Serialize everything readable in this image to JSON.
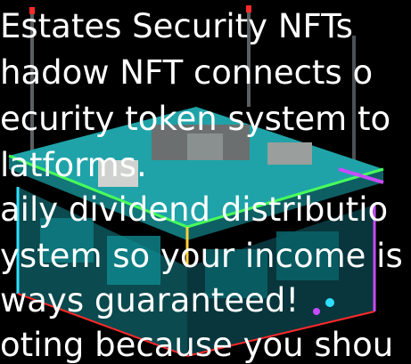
{
  "overlay": {
    "lines": [
      "Estates Security NFTs",
      "hadow NFT connects o",
      "ecurity token system to",
      "latforms.",
      "aily dividend distributio",
      "ystem so your income is",
      "ways guaranteed!",
      "oting because you shou"
    ]
  },
  "colors": {
    "background": "#000000",
    "roof": "#1fa3a8",
    "neon_green": "#48ff5a",
    "neon_yellow": "#ffd23a",
    "neon_cyan": "#2de0ff",
    "neon_magenta": "#c84bff",
    "neon_red": "#ff2a2a",
    "wall_dark": "#0d2a33"
  },
  "icons": [
    "building-illustration",
    "antenna-icon"
  ]
}
